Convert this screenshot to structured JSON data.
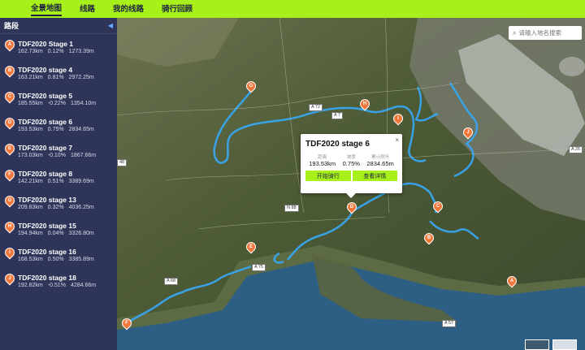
{
  "nav": {
    "items": [
      {
        "label": "全景地图",
        "active": true
      },
      {
        "label": "线路",
        "active": false
      },
      {
        "label": "我的线路",
        "active": false
      },
      {
        "label": "骑行回顾",
        "active": false
      }
    ]
  },
  "sidebar": {
    "title": "路段",
    "collapse_icon": "chevron-left-icon",
    "routes": [
      {
        "badge": "A",
        "name": "TDF2020 Stage 1",
        "distance": "162.73km",
        "grade": "0.12%",
        "elevation": "1273.39m"
      },
      {
        "badge": "B",
        "name": "TDF2020 stage 4",
        "distance": "163.21km",
        "grade": "0.81%",
        "elevation": "2972.25m"
      },
      {
        "badge": "C",
        "name": "TDF2020 stage 5",
        "distance": "185.55km",
        "grade": "-0.22%",
        "elevation": "1354.10m"
      },
      {
        "badge": "D",
        "name": "TDF2020 stage 6",
        "distance": "193.53km",
        "grade": "0.75%",
        "elevation": "2834.65m"
      },
      {
        "badge": "E",
        "name": "TDF2020 stage 7",
        "distance": "173.03km",
        "grade": "-0.10%",
        "elevation": "1867.66m"
      },
      {
        "badge": "F",
        "name": "TDF2020 stage 8",
        "distance": "142.21km",
        "grade": "0.51%",
        "elevation": "3389.69m"
      },
      {
        "badge": "G",
        "name": "TDF2020 stage 13",
        "distance": "209.83km",
        "grade": "0.32%",
        "elevation": "4036.25m"
      },
      {
        "badge": "H",
        "name": "TDF2020 stage 15",
        "distance": "194.94km",
        "grade": "0.04%",
        "elevation": "3326.80m"
      },
      {
        "badge": "I",
        "name": "TDF2020 stage 16",
        "distance": "168.53km",
        "grade": "0.50%",
        "elevation": "3385.89m"
      },
      {
        "badge": "J",
        "name": "TDF2020 stage 18",
        "distance": "192.82km",
        "grade": "-0.51%",
        "elevation": "4284.66m"
      }
    ]
  },
  "search": {
    "placeholder": "请输入地名搜索",
    "icon": "search-icon"
  },
  "popup": {
    "title": "TDF2020 stage 6",
    "close_icon": "close-icon",
    "stats": [
      {
        "label": "距离",
        "value": "193.53km"
      },
      {
        "label": "坡度",
        "value": "0.75%"
      },
      {
        "label": "累计爬升",
        "value": "2834.65m"
      }
    ],
    "start_button": "开始骑行",
    "detail_button": "查看详情"
  },
  "map": {
    "markers": [
      {
        "badge": "A"
      },
      {
        "badge": "B"
      },
      {
        "badge": "C"
      },
      {
        "badge": "D"
      },
      {
        "badge": "E"
      },
      {
        "badge": "F"
      },
      {
        "badge": "G"
      },
      {
        "badge": "H"
      },
      {
        "badge": "I"
      },
      {
        "badge": "J"
      }
    ],
    "road_labels": [
      "A 72",
      "A 75",
      "A 68",
      "A 57",
      "N 88",
      "A 26",
      "A 7",
      "48"
    ],
    "colors": {
      "accent": "#a8f01a",
      "marker": "#f0763a",
      "route": "#3aa0e8",
      "sidebar": "#2f3558"
    }
  }
}
